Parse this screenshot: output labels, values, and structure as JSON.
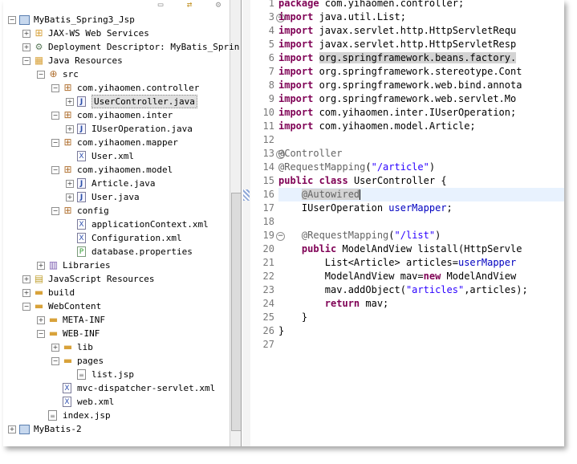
{
  "explorer": {
    "rows": [
      {
        "label": "MyBatis_Spring3_Jsp",
        "indent": 0,
        "twisty": "−",
        "icon": "project-icon"
      },
      {
        "label": "JAX-WS Web Services",
        "indent": 1,
        "twisty": "+",
        "icon": "web-services-icon"
      },
      {
        "label": "Deployment Descriptor: MyBatis_Sprin",
        "indent": 1,
        "twisty": "+",
        "icon": "deployment-descriptor-icon"
      },
      {
        "label": "Java Resources",
        "indent": 1,
        "twisty": "−",
        "icon": "java-resources-icon"
      },
      {
        "label": "src",
        "indent": 2,
        "twisty": "−",
        "icon": "source-folder-icon"
      },
      {
        "label": "com.yihaomen.controller",
        "indent": 3,
        "twisty": "−",
        "icon": "package-icon"
      },
      {
        "label": "UserController.java",
        "indent": 4,
        "twisty": "+",
        "icon": "java-file-icon",
        "selected": true
      },
      {
        "label": "com.yihaomen.inter",
        "indent": 3,
        "twisty": "−",
        "icon": "package-icon"
      },
      {
        "label": "IUserOperation.java",
        "indent": 4,
        "twisty": "+",
        "icon": "java-file-icon"
      },
      {
        "label": "com.yihaomen.mapper",
        "indent": 3,
        "twisty": "−",
        "icon": "package-icon"
      },
      {
        "label": "User.xml",
        "indent": 4,
        "twisty": "",
        "icon": "xml-file-icon"
      },
      {
        "label": "com.yihaomen.model",
        "indent": 3,
        "twisty": "−",
        "icon": "package-icon"
      },
      {
        "label": "Article.java",
        "indent": 4,
        "twisty": "+",
        "icon": "java-file-icon"
      },
      {
        "label": "User.java",
        "indent": 4,
        "twisty": "+",
        "icon": "java-file-icon"
      },
      {
        "label": "config",
        "indent": 3,
        "twisty": "−",
        "icon": "package-icon"
      },
      {
        "label": "applicationContext.xml",
        "indent": 4,
        "twisty": "",
        "icon": "xml-file-icon"
      },
      {
        "label": "Configuration.xml",
        "indent": 4,
        "twisty": "",
        "icon": "xml-file-icon"
      },
      {
        "label": "database.properties",
        "indent": 4,
        "twisty": "",
        "icon": "properties-file-icon"
      },
      {
        "label": "Libraries",
        "indent": 2,
        "twisty": "+",
        "icon": "libraries-icon"
      },
      {
        "label": "JavaScript Resources",
        "indent": 1,
        "twisty": "+",
        "icon": "javascript-resources-icon"
      },
      {
        "label": "build",
        "indent": 1,
        "twisty": "+",
        "icon": "folder-icon"
      },
      {
        "label": "WebContent",
        "indent": 1,
        "twisty": "−",
        "icon": "folder-icon"
      },
      {
        "label": "META-INF",
        "indent": 2,
        "twisty": "+",
        "icon": "folder-icon"
      },
      {
        "label": "WEB-INF",
        "indent": 2,
        "twisty": "−",
        "icon": "folder-icon"
      },
      {
        "label": "lib",
        "indent": 3,
        "twisty": "+",
        "icon": "folder-icon"
      },
      {
        "label": "pages",
        "indent": 3,
        "twisty": "−",
        "icon": "folder-icon"
      },
      {
        "label": "list.jsp",
        "indent": 4,
        "twisty": "",
        "icon": "jsp-file-icon"
      },
      {
        "label": "mvc-dispatcher-servlet.xml",
        "indent": 3,
        "twisty": "",
        "icon": "xml-file-icon"
      },
      {
        "label": "web.xml",
        "indent": 3,
        "twisty": "",
        "icon": "xml-file-icon"
      },
      {
        "label": "index.jsp",
        "indent": 2,
        "twisty": "",
        "icon": "jsp-file-icon"
      },
      {
        "label": "MyBatis-2",
        "indent": 0,
        "twisty": "+",
        "icon": "project-icon"
      }
    ]
  },
  "editor": {
    "lines": [
      {
        "n": "1",
        "code": [
          [
            "kw",
            "package"
          ],
          [
            "t",
            " com.yihaomen.controller;"
          ]
        ]
      },
      {
        "n": "3",
        "fold": "−",
        "code": [
          [
            "kw",
            "import"
          ],
          [
            "t",
            " java.util.List;"
          ]
        ]
      },
      {
        "n": "4",
        "code": [
          [
            "kw",
            "import"
          ],
          [
            "t",
            " javax.servlet.http.HttpServletRequ"
          ]
        ]
      },
      {
        "n": "5",
        "code": [
          [
            "kw",
            "import"
          ],
          [
            "t",
            " javax.servlet.http.HttpServletResp"
          ]
        ]
      },
      {
        "n": "6",
        "code": [
          [
            "kw",
            "import"
          ],
          [
            "t",
            " "
          ],
          [
            "hl",
            "org.springframework.beans.factory."
          ]
        ]
      },
      {
        "n": "7",
        "code": [
          [
            "kw",
            "import"
          ],
          [
            "t",
            " org.springframework.stereotype.Cont"
          ]
        ]
      },
      {
        "n": "8",
        "code": [
          [
            "kw",
            "import"
          ],
          [
            "t",
            " org.springframework.web.bind.annota"
          ]
        ]
      },
      {
        "n": "9",
        "code": [
          [
            "kw",
            "import"
          ],
          [
            "t",
            " org.springframework.web.servlet.Mo"
          ]
        ]
      },
      {
        "n": "10",
        "code": [
          [
            "kw",
            "import"
          ],
          [
            "t",
            " com.yihaomen.inter.IUserOperation;"
          ]
        ]
      },
      {
        "n": "11",
        "code": [
          [
            "kw",
            "import"
          ],
          [
            "t",
            " com.yihaomen.model.Article;"
          ]
        ]
      },
      {
        "n": "12",
        "code": []
      },
      {
        "n": "13",
        "fold": "−",
        "code": [
          [
            "ann",
            "@Controller"
          ]
        ]
      },
      {
        "n": "14",
        "code": [
          [
            "ann",
            "@RequestMapping"
          ],
          [
            "t",
            "("
          ],
          [
            "str",
            "\"/article\""
          ],
          [
            "t",
            ")"
          ]
        ]
      },
      {
        "n": "15",
        "code": [
          [
            "kw",
            "public"
          ],
          [
            "t",
            " "
          ],
          [
            "kw",
            "class"
          ],
          [
            "t",
            " UserController {"
          ]
        ]
      },
      {
        "n": "16",
        "mark": true,
        "current": true,
        "code": [
          [
            "t",
            "    "
          ],
          [
            "annhl",
            "@Autowired"
          ],
          [
            "caret",
            ""
          ]
        ]
      },
      {
        "n": "17",
        "code": [
          [
            "t",
            "    IUserOperation "
          ],
          [
            "fld",
            "userMapper"
          ],
          [
            "t",
            ";"
          ]
        ]
      },
      {
        "n": "18",
        "code": []
      },
      {
        "n": "19",
        "fold": "−",
        "code": [
          [
            "t",
            "    "
          ],
          [
            "ann",
            "@RequestMapping"
          ],
          [
            "t",
            "("
          ],
          [
            "str",
            "\"/list\""
          ],
          [
            "t",
            ")"
          ]
        ]
      },
      {
        "n": "20",
        "code": [
          [
            "t",
            "    "
          ],
          [
            "kw",
            "public"
          ],
          [
            "t",
            " ModelAndView listall(HttpServle"
          ]
        ]
      },
      {
        "n": "21",
        "code": [
          [
            "t",
            "        List<Article> articles="
          ],
          [
            "fld",
            "userMapper"
          ]
        ]
      },
      {
        "n": "22",
        "code": [
          [
            "t",
            "        ModelAndView mav="
          ],
          [
            "kw",
            "new"
          ],
          [
            "t",
            " ModelAndView"
          ]
        ]
      },
      {
        "n": "23",
        "code": [
          [
            "t",
            "        mav.addObject("
          ],
          [
            "str",
            "\"articles\""
          ],
          [
            "t",
            ",articles);"
          ]
        ]
      },
      {
        "n": "24",
        "code": [
          [
            "t",
            "        "
          ],
          [
            "kw",
            "return"
          ],
          [
            "t",
            " mav;"
          ]
        ]
      },
      {
        "n": "25",
        "code": [
          [
            "t",
            "    }"
          ]
        ]
      },
      {
        "n": "26",
        "code": [
          [
            "t",
            "}"
          ]
        ]
      },
      {
        "n": "27",
        "code": []
      }
    ]
  }
}
